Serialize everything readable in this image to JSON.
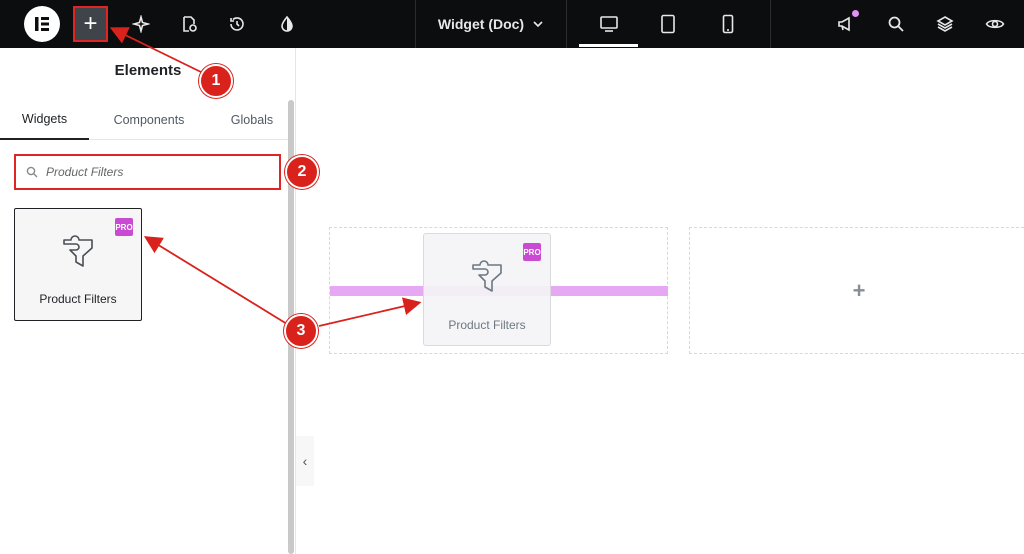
{
  "topbar": {
    "document_title": "Widget (Doc)",
    "colors": {
      "background": "#0c0d0e",
      "accent": "#e190f5"
    },
    "icons": [
      "elementor-logo-icon",
      "plus-icon",
      "sparkle-icon",
      "page-settings-icon",
      "history-icon",
      "contrast-icon",
      "chevron-down-icon",
      "desktop-icon",
      "tablet-icon",
      "mobile-icon",
      "megaphone-icon",
      "search-icon",
      "layers-icon",
      "eye-icon"
    ]
  },
  "panel": {
    "title": "Elements",
    "tabs": [
      {
        "label": "Widgets",
        "active": true
      },
      {
        "label": "Components",
        "active": false
      },
      {
        "label": "Globals",
        "active": false
      }
    ],
    "search": {
      "placeholder": "Product Filters"
    },
    "widgets": [
      {
        "label": "Product Filters",
        "badge": "PRO"
      }
    ]
  },
  "canvas": {
    "dragging_widget": {
      "label": "Product Filters"
    },
    "drop_indicator_color": "#e6a8f2"
  },
  "annotations": {
    "steps": [
      "1",
      "2",
      "3"
    ],
    "color": "#d9221c"
  }
}
